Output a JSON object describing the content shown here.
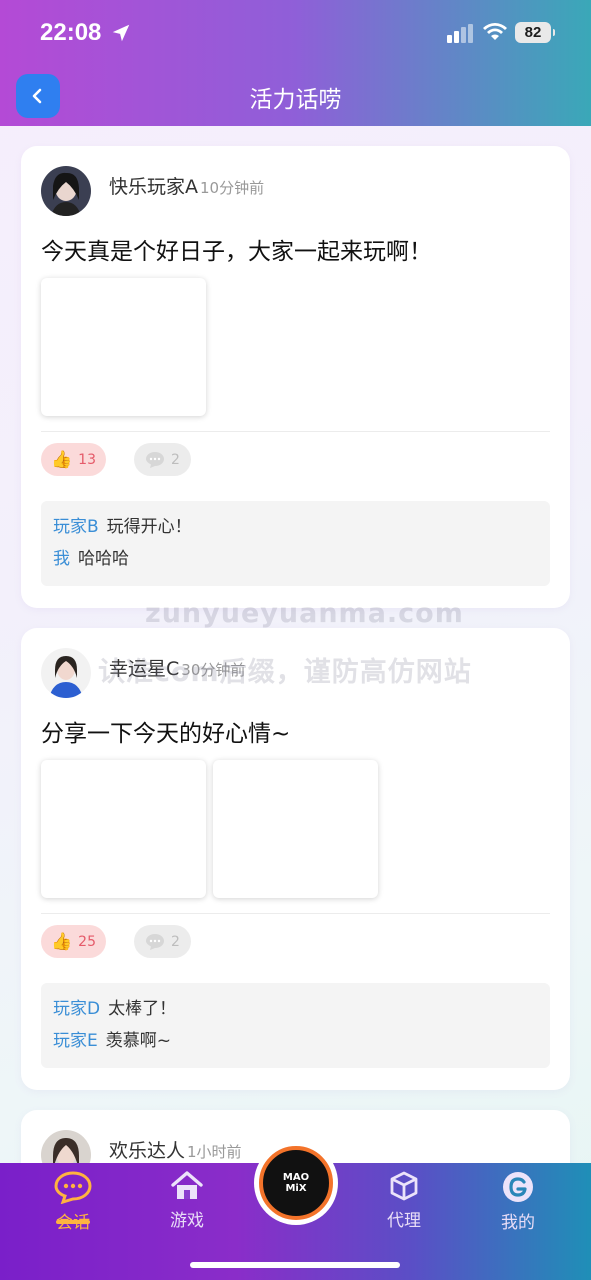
{
  "status_bar": {
    "time": "22:08",
    "battery": "82"
  },
  "header": {
    "title": "活力话唠"
  },
  "posts": [
    {
      "username": "快乐玩家A",
      "time_ago": "10分钟前",
      "text": "今天真是个好日子，大家一起来玩啊！",
      "image_count": 1,
      "likes": "13",
      "comments": "2",
      "comment_list": [
        {
          "author": "玩家B",
          "text": "玩得开心！"
        },
        {
          "author": "我",
          "text": "哈哈哈"
        }
      ]
    },
    {
      "username": "幸运星C",
      "time_ago": "30分钟前",
      "text": "分享一下今天的好心情~",
      "image_count": 2,
      "likes": "25",
      "comments": "2",
      "comment_list": [
        {
          "author": "玩家D",
          "text": "太棒了！"
        },
        {
          "author": "玩家E",
          "text": "羡慕啊~"
        }
      ]
    },
    {
      "username": "欢乐达人",
      "time_ago": "1小时前"
    }
  ],
  "watermark": {
    "line1": "zunyueyuanma.com",
    "line2": "认准com后缀，谨防高仿网站"
  },
  "bottom_nav": {
    "items": [
      {
        "label": "会话",
        "icon": "chat-bubble-icon",
        "active": true
      },
      {
        "label": "游戏",
        "icon": "home-icon",
        "active": false
      },
      {
        "label": "代理",
        "icon": "cube-icon",
        "active": false
      },
      {
        "label": "我的",
        "icon": "profile-g-icon",
        "active": false
      }
    ],
    "center_logo_text": [
      "MAO",
      "MiX"
    ]
  },
  "colors": {
    "accent_blue": "#2f7ff0",
    "like_bg": "#fbdada",
    "link": "#3a8ed6",
    "nav_active": "#ffb340"
  }
}
